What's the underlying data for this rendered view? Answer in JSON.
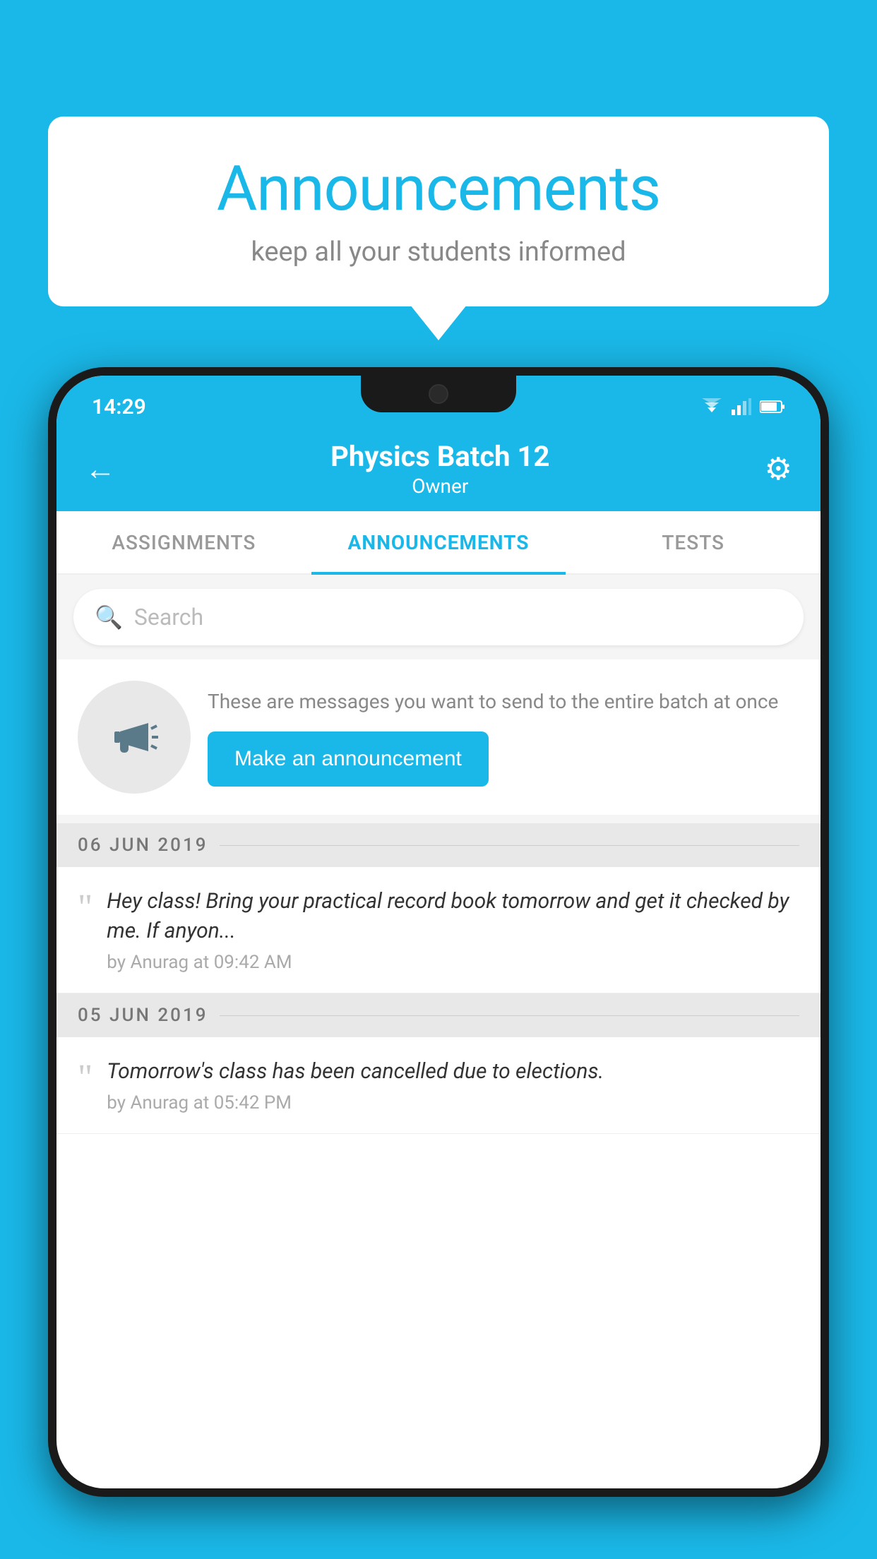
{
  "background_color": "#1ab8e8",
  "bubble": {
    "title": "Announcements",
    "subtitle": "keep all your students informed"
  },
  "status_bar": {
    "time": "14:29"
  },
  "app_bar": {
    "title": "Physics Batch 12",
    "subtitle": "Owner",
    "back_label": "←",
    "gear_label": "⚙"
  },
  "tabs": [
    {
      "label": "ASSIGNMENTS",
      "active": false
    },
    {
      "label": "ANNOUNCEMENTS",
      "active": true
    },
    {
      "label": "TESTS",
      "active": false
    }
  ],
  "search": {
    "placeholder": "Search"
  },
  "promo": {
    "description": "These are messages you want to send to the entire batch at once",
    "button_label": "Make an announcement"
  },
  "date_groups": [
    {
      "date": "06  JUN  2019",
      "announcements": [
        {
          "text": "Hey class! Bring your practical record book tomorrow and get it checked by me. If anyon...",
          "meta": "by Anurag at 09:42 AM"
        }
      ]
    },
    {
      "date": "05  JUN  2019",
      "announcements": [
        {
          "text": "Tomorrow's class has been cancelled due to elections.",
          "meta": "by Anurag at 05:42 PM"
        }
      ]
    }
  ]
}
